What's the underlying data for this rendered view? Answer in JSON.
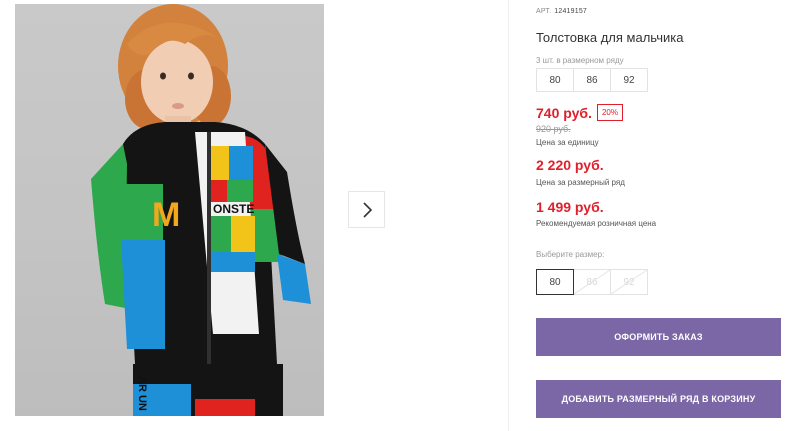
{
  "product": {
    "article_label": "АРТ.",
    "article_value": "12419157",
    "title": "Толстовка для мальчика",
    "sizes_caption": "3 шт. в размерном ряду",
    "size_set": [
      "80",
      "86",
      "92"
    ],
    "price": "740 руб.",
    "discount": "20%",
    "old_price": "920 руб.",
    "price_unit_caption": "Цена за единицу",
    "price_set": "2 220 руб.",
    "price_set_caption": "Цена за размерный ряд",
    "rrp": "1 499 руб.",
    "rrp_caption": "Рекомендуемая розничная цена",
    "choose_caption": "Выберите размер:",
    "choose_sizes": [
      {
        "label": "80",
        "state": "selected"
      },
      {
        "label": "86",
        "state": "disabled"
      },
      {
        "label": "92",
        "state": "disabled"
      }
    ]
  },
  "photo": {
    "shirt_print_text": "ONSTE",
    "jacket_letter": "M",
    "pants_print_text": "AR UN"
  },
  "actions": {
    "order_label": "ОФОРМИТЬ ЗАКАЗ",
    "add_to_cart_label": "ДОБАВИТЬ РАЗМЕРНЫЙ РЯД В КОРЗИНУ"
  },
  "colors": {
    "accent": "#7b66a6",
    "price_red": "#e01f2b"
  },
  "icons": {
    "next": "chevron-right-icon"
  }
}
